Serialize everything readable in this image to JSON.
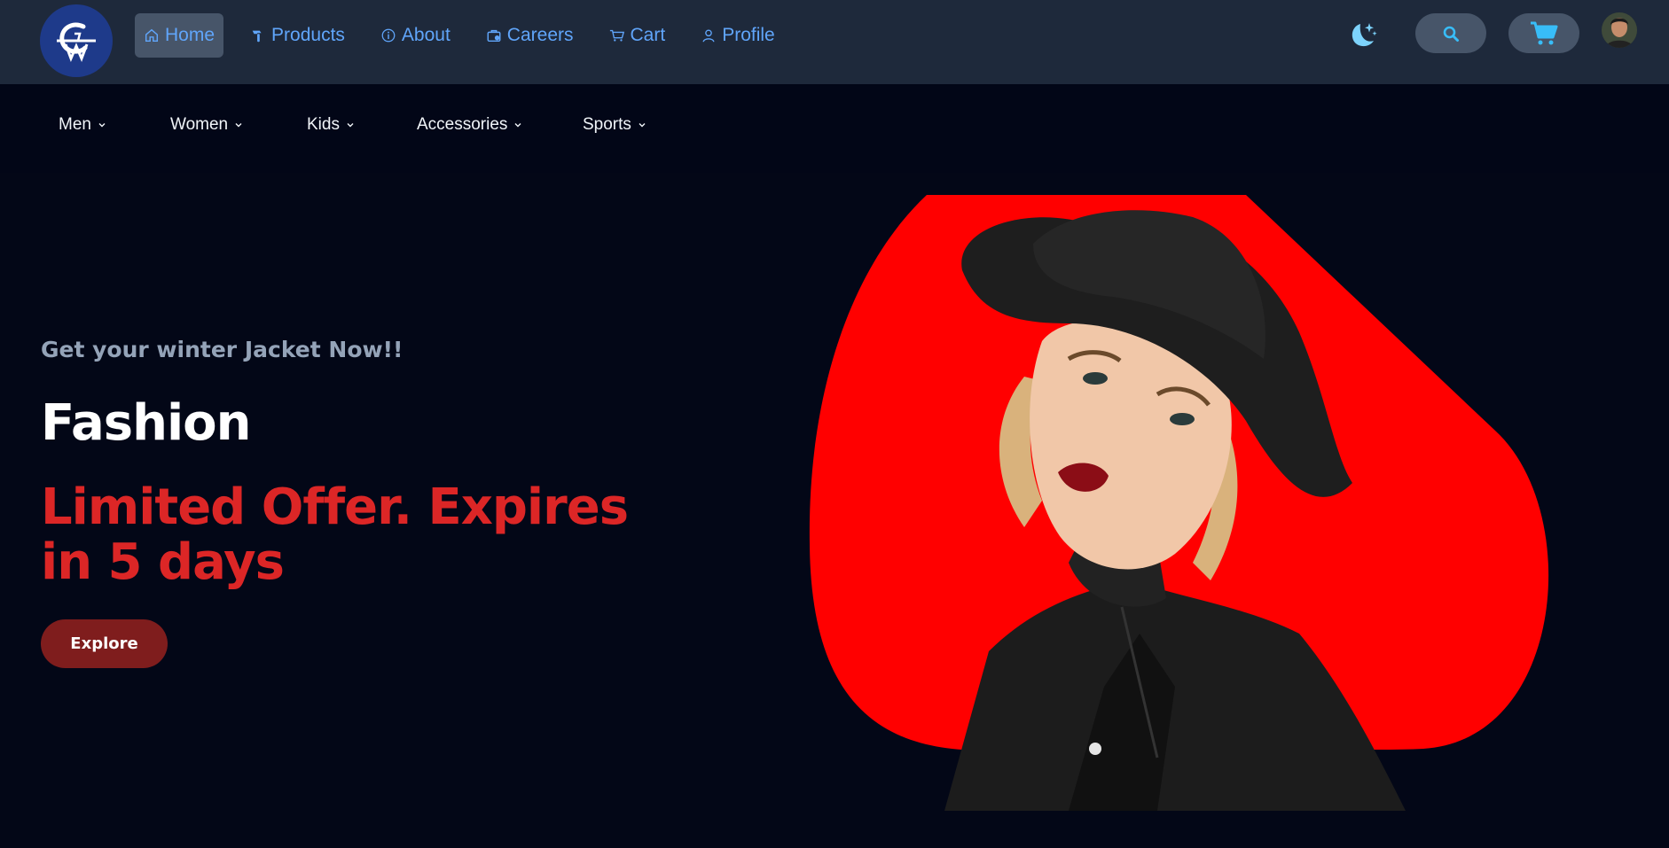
{
  "header": {
    "logo_icon": "brand-logo-icon",
    "nav": [
      {
        "label": "Home",
        "icon": "home-icon",
        "active": true
      },
      {
        "label": "Products",
        "icon": "hammer-icon",
        "active": false
      },
      {
        "label": "About",
        "icon": "info-icon",
        "active": false
      },
      {
        "label": "Careers",
        "icon": "briefcase-icon",
        "active": false
      },
      {
        "label": "Cart",
        "icon": "cart-icon",
        "active": false
      },
      {
        "label": "Profile",
        "icon": "user-icon",
        "active": false
      }
    ],
    "theme_icon": "moon-stars-icon",
    "search_icon": "search-icon",
    "cart_icon": "shopping-cart-icon"
  },
  "categories": [
    {
      "label": "Men"
    },
    {
      "label": "Women"
    },
    {
      "label": "Kids"
    },
    {
      "label": "Accessories"
    },
    {
      "label": "Sports"
    }
  ],
  "hero": {
    "subtitle": "Get your winter Jacket Now!!",
    "title": "Fashion",
    "offer": "Limited Offer. Expires in 5 days",
    "cta_label": "Explore"
  },
  "colors": {
    "topbar_bg": "#1e293b",
    "page_bg": "#030717",
    "nav_text": "#60a5fa",
    "active_bg": "#475569",
    "offer_red": "#dc2626",
    "cta_bg": "#7f1d1d",
    "blob_red": "#ff0000"
  }
}
